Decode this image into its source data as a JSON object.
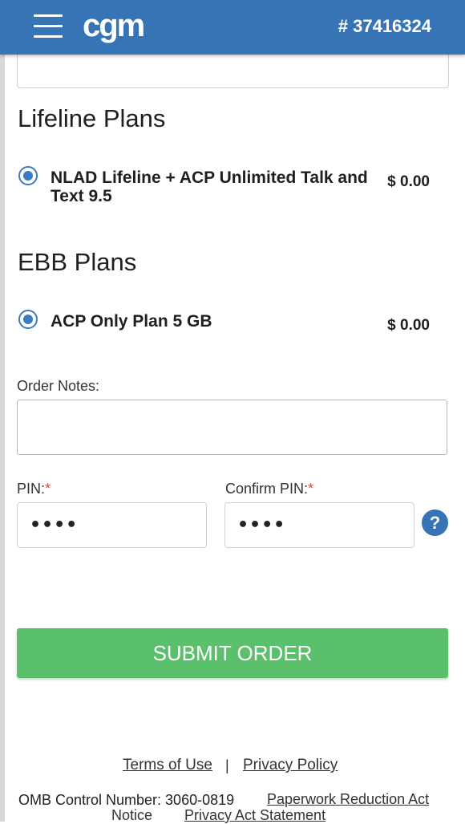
{
  "header": {
    "logo": "cgm",
    "account_number": "# 37416324"
  },
  "lifeline": {
    "title": "Lifeline Plans",
    "plan_name_line1": "NLAD Lifeline + ACP Unlimited Talk and",
    "plan_name_line2": "Text 9.5",
    "plan_price": "$ 0.00",
    "selected": true
  },
  "ebb": {
    "title": "EBB Plans",
    "plan_name": "ACP Only Plan 5 GB",
    "plan_price": "$ 0.00",
    "selected": true
  },
  "order_notes": {
    "label": "Order Notes:",
    "value": ""
  },
  "pin": {
    "label": "PIN:",
    "required_mark": "*",
    "value": "••••"
  },
  "confirm_pin": {
    "label": "Confirm PIN:",
    "required_mark": "*",
    "value": "••••"
  },
  "help": {
    "icon": "question-icon",
    "glyph": "?"
  },
  "submit_label": "SUBMIT ORDER",
  "footer": {
    "terms": "Terms of Use",
    "separator": "|",
    "privacy": "Privacy Policy",
    "omb": "OMB Control Number: 3060-0819",
    "paperwork": "Paperwork Reduction Act",
    "notice": "Notice",
    "privacy_act": "Privacy Act Statement"
  },
  "colors": {
    "header": "#3674b5",
    "radio": "#3a7cc2",
    "submit": "#5bc06c",
    "required": "#e04a3f"
  }
}
